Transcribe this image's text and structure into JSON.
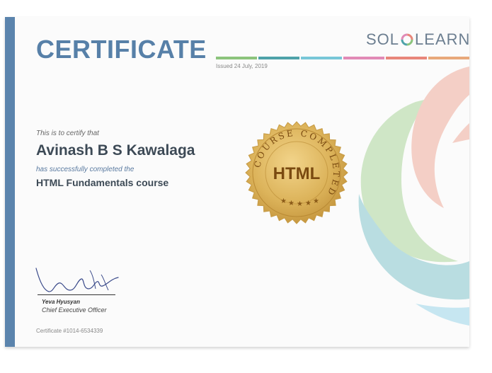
{
  "certificate": {
    "title": "CERTIFICATE",
    "issued": "Issued 24 July, 2019",
    "intro": "This is to certify that",
    "recipient": "Avinash B S Kawalaga",
    "completed_text": "has successfully completed the",
    "course": "HTML Fundamentals course",
    "seal_course": "HTML",
    "seal_ring_text": "COURSE COMPLETED",
    "signer_name": "Yeva Hyusyan",
    "signer_title": "Chief Executive Officer",
    "certificate_number": "Certificate #1014-6534339"
  },
  "brand": {
    "logo_left": "SOL",
    "logo_right": "LEARN",
    "logo_icon": "solo-ring-icon"
  },
  "colors": {
    "accent": "#5780a8",
    "stripe": "#5b84ad",
    "bar": [
      "#8cc47c",
      "#4ea2a9",
      "#78c7d8",
      "#e18ab6",
      "#e8867a",
      "#e8a87a"
    ],
    "seal_gold": "#d4a94b",
    "seal_text": "#7a4a10"
  },
  "icons": [
    "solo-ring-icon",
    "seal-badge-icon",
    "star-icon",
    "signature-image"
  ]
}
